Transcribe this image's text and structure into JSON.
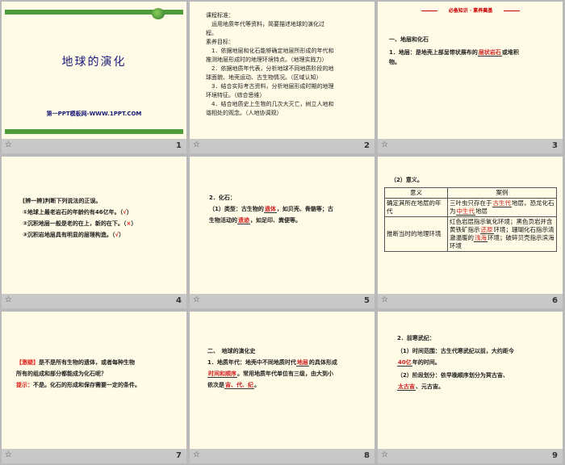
{
  "slides": [
    {
      "num": "1",
      "title": "地球的演化",
      "subtitle": "第一PPT模板网-WWW.1PPT.COM"
    },
    {
      "num": "2",
      "lines": [
        "课程标准：",
        "　运用地质年代等资料，简要描述地球的演化过",
        "程。",
        "素养目标：",
        "　1．依据地层和化石能够确定地层所形成的年代和",
        "推测地层形成时的地理环境特点。（地理实践力）",
        "　2．依据地质年代表，分析地球不同地质阶段的地",
        "球面貌、地壳运动、古生物情况。（区域认知）",
        "　3．结合实际考古资料，分析地层形成时期的地理",
        "环境特征。（综合思维）",
        "　4．结合地质史上生物的几次大灭亡，树立人地和",
        "谐相处的观念。（人地协调观）"
      ]
    },
    {
      "num": "3",
      "banner": "必备知识 · 素养奠基",
      "heading": "一、地层和化石",
      "line1_a": "1．地层：是地壳上部呈带状展布的",
      "line1_ans": "层状岩石",
      "line1_b": "或堆积",
      "line2": "物。"
    },
    {
      "num": "4",
      "heading": "[辨一辨]判断下列说法的正误。",
      "items": [
        {
          "text": "①地球上最老岩石的年龄约有46亿年。（",
          "mark": "√",
          "end": "）"
        },
        {
          "text": "②沉积地层一般是老的在上，新的在下。（",
          "mark": "×",
          "end": "）"
        },
        {
          "text": "③沉积岩地层具有明显的层理构造。（",
          "mark": "√",
          "end": "）"
        }
      ]
    },
    {
      "num": "5",
      "heading": "2．化石：",
      "l1_a": "（1）类型：古生物的",
      "l1_ans": "遗体",
      "l1_b": "，如贝壳、骨骼等；古",
      "l2_a": "生物活动的",
      "l2_ans": "遗迹",
      "l2_b": "，如足印、粪便等。"
    },
    {
      "num": "6",
      "heading": "（2）意义。",
      "col1": "意义",
      "col2": "案例",
      "r1_c1": "确定其所在地层的年代",
      "r1_c2_a": "三叶虫只存在于",
      "r1_c2_ans1": "古生代",
      "r1_c2_b": "地层，恐龙化石为",
      "r1_c2_ans2": "中生代",
      "r1_c2_c": "地层",
      "r2_c1": "推断当时的地理环境",
      "r2_c2_a": "红色岩层指示氧化环境；黑色页岩并含黄铁矿指示",
      "r2_c2_ans1": "还原",
      "r2_c2_b": "环境；珊瑚化石指示清澈温暖的",
      "r2_c2_ans2": "浅海",
      "r2_c2_c": "环境；破碎贝壳指示滨海环境"
    },
    {
      "num": "7",
      "l1_tag": "【激疑】",
      "l1": "是不是所有生物的遗体，或者每种生物",
      "l2": "所有的组成和部分都能成为化石呢？",
      "l3_tag": "提示：",
      "l3": "不是。化石的形成和保存需要一定的条件。"
    },
    {
      "num": "8",
      "heading": "二、　地球的演化史",
      "l1_a": "1．地质年代：地壳中不同地质时代",
      "l1_ans": "地层",
      "l1_b": "的具体形成",
      "l2_ans": "时间和顺序",
      "l2_b": "。常用地质年代单位有三级，由大到小",
      "l3_a": "依次是",
      "l3_ans": "宙、代、纪",
      "l3_b": "。"
    },
    {
      "num": "9",
      "heading": "2．前寒武纪：",
      "l1": "（1）时间范围：古生代寒武纪以前，大约距今",
      "l2_ans": "40亿",
      "l2_b": "年的时间。",
      "l3": "（2）阶段划分：依早晚顺序划分为冥古宙、",
      "l4_ans": "太古宙",
      "l4_b": "、元古宙。"
    }
  ]
}
